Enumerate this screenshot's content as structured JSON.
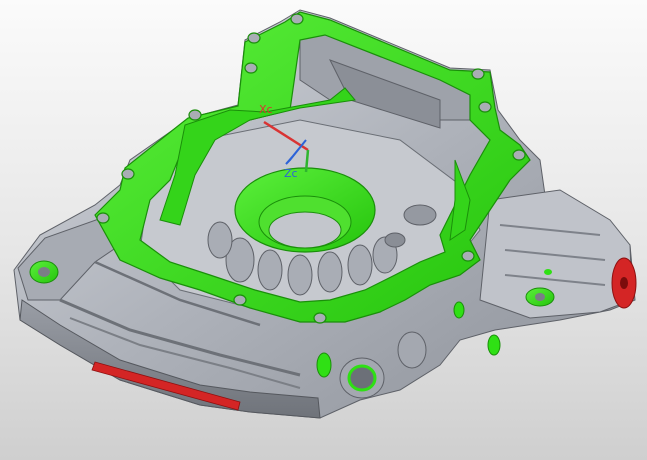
{
  "viewport": {
    "background_top": "#fbfbfb",
    "background_bottom": "#cfcfcf"
  },
  "model": {
    "body_color": "#b9bcc3",
    "highlight_color": "#2fe014",
    "highlight_edge_color": "#1a8f0a",
    "cut_face_color": "#d42525"
  },
  "csys": {
    "x_label": "Xc",
    "z_label": "Zc",
    "x_color": "#d93333",
    "y_color": "#2fb52f",
    "z_color": "#2c63d8"
  }
}
